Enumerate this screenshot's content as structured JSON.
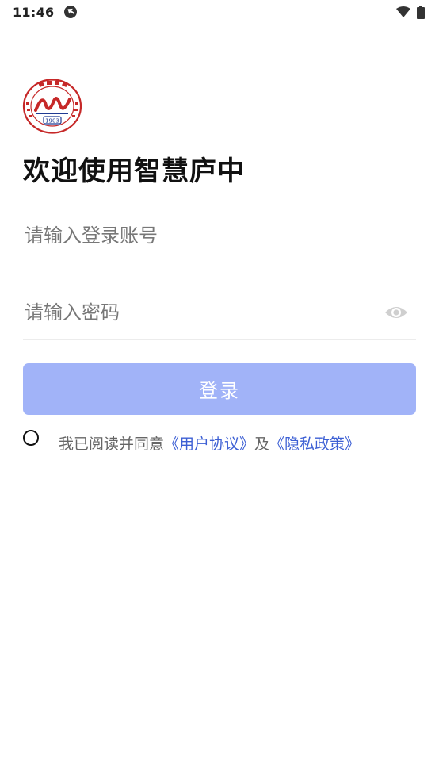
{
  "status_bar": {
    "time": "11:46",
    "icons": [
      "sync-icon",
      "wifi-icon",
      "battery-icon"
    ]
  },
  "logo": {
    "name": "school-logo",
    "year_text": "1903"
  },
  "welcome_title": "欢迎使用智慧庐中",
  "account_input": {
    "placeholder": "请输入登录账号",
    "value": ""
  },
  "password_input": {
    "placeholder": "请输入密码",
    "value": "",
    "toggle_icon": "eye-icon"
  },
  "login_button": {
    "label": "登录",
    "color": "#a1b3f8"
  },
  "agreement": {
    "prefix": "我已阅读并同意",
    "user_agreement": "《用户协议》",
    "conjunction": "及",
    "privacy_policy": "《隐私政策》",
    "link_color": "#3c5fd4",
    "checked": false
  }
}
